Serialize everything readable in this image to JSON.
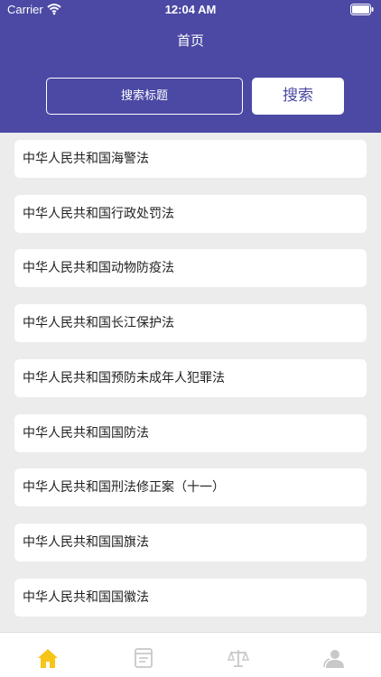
{
  "status_bar": {
    "carrier": "Carrier",
    "time": "12:04 AM"
  },
  "header": {
    "title": "首页"
  },
  "search": {
    "placeholder": "搜索标题",
    "button_label": "搜索"
  },
  "laws": [
    "中华人民共和国海警法",
    "中华人民共和国行政处罚法",
    "中华人民共和国动物防疫法",
    "中华人民共和国长江保护法",
    "中华人民共和国预防未成年人犯罪法",
    "中华人民共和国国防法",
    "中华人民共和国刑法修正案（十一）",
    "中华人民共和国国旗法",
    "中华人民共和国国徽法"
  ],
  "tabbar": {
    "tabs": [
      {
        "icon": "home-icon",
        "active": true
      },
      {
        "icon": "document-icon",
        "active": false
      },
      {
        "icon": "scales-icon",
        "active": false
      },
      {
        "icon": "user-icon",
        "active": false
      }
    ]
  },
  "colors": {
    "header": "#4b49a4",
    "active_tab": "#f6c518",
    "inactive_tab": "#c8c8c8"
  }
}
